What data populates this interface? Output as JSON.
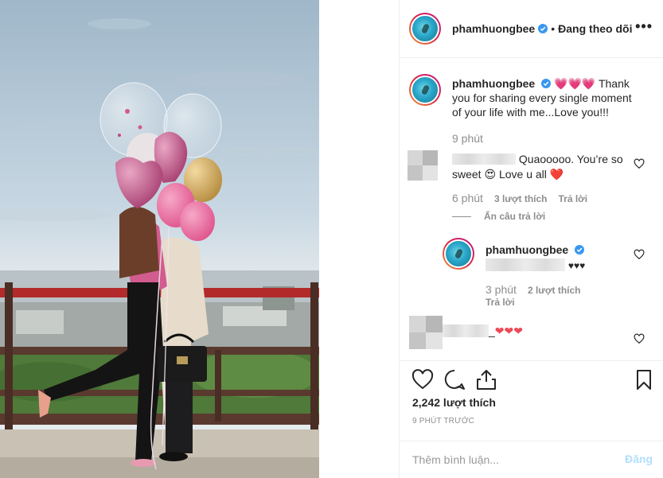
{
  "post": {
    "username": "phamhuongbee",
    "separator": "•",
    "follow_status": "Đang theo dõi",
    "more_label": "•••"
  },
  "caption": {
    "username": "phamhuongbee",
    "hearts": "💗💗💗",
    "text": " Thank you for sharing every single moment of your life with me...Love you!!!",
    "time": "9 phút"
  },
  "comments": [
    {
      "text_part1": "Quaooooo. You’re so sweet ",
      "emoji1": "😍",
      "text_part2": " Love u all ",
      "emoji2": "❤️",
      "time": "6 phút",
      "likes": "3 lượt thích",
      "reply_label": "Trả lời",
      "hide_replies_label": "Ẩn câu trả lời"
    },
    {
      "username": "phamhuongbee",
      "hearts": "♥♥♥",
      "time": "3 phút",
      "likes": "2 lượt thích",
      "reply_label": "Trả lời"
    },
    {
      "text_suffix": "_ ",
      "hearts": "❤❤❤"
    }
  ],
  "footer": {
    "likes_count": "2,242 lượt thích",
    "time_ago": "9 PHÚT TRƯỚC",
    "comment_placeholder": "Thêm bình luận...",
    "post_label": "Đăng"
  },
  "colors": {
    "link_disabled": "#b2dffc",
    "muted": "#8e8e8e",
    "heart": "#ed4956",
    "verified": "#3897f0"
  },
  "icons": [
    "heart-icon",
    "comment-icon",
    "share-icon",
    "bookmark-icon",
    "verified-badge-icon",
    "more-options-icon"
  ]
}
